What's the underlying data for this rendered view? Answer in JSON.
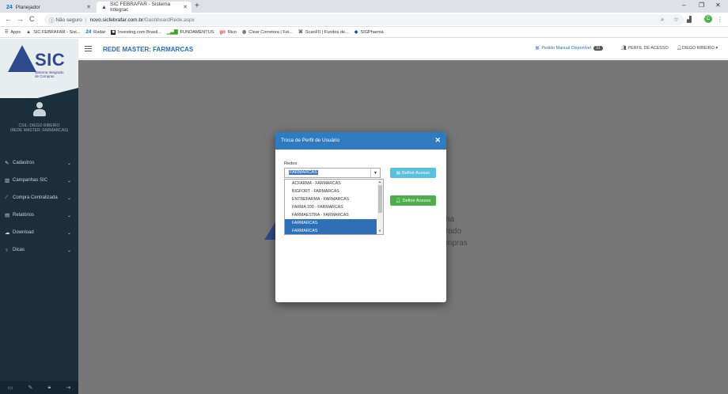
{
  "browser": {
    "tabs": [
      {
        "icon": "24",
        "label": "Planejador",
        "active": false
      },
      {
        "icon": "sic",
        "label": "SIC FEBRAFAR - Sistema Integrac",
        "active": true
      }
    ],
    "address": {
      "security": "Não seguro",
      "host": "novo.sicfebrafar.com.br",
      "path": "/DashboardRede.aspx"
    },
    "avatar_letter": "C",
    "bookmarks": [
      {
        "icon": "apps",
        "label": "Apps"
      },
      {
        "icon": "sic",
        "label": "SIC FEBRAFAR - Sist..."
      },
      {
        "icon": "24",
        "label": "Radar"
      },
      {
        "icon": "inv",
        "label": "Investing.com Brasil..."
      },
      {
        "icon": "chart",
        "label": "FUNDAMENTUS"
      },
      {
        "icon": "go",
        "label": "Rico"
      },
      {
        "icon": "clear",
        "label": "Clear Corretora | Fei..."
      },
      {
        "icon": "fii",
        "label": "ScanFII | Fundos de..."
      },
      {
        "icon": "sig",
        "label": "SIGPharma"
      }
    ]
  },
  "sidebar": {
    "logo_text": "SIC",
    "logo_sub": "Sistema Integrado de Compras",
    "user_line1": "CSIL: DIEGO RIBEIRO",
    "user_line2": "(REDE MASTER: FARMARCAS)",
    "menu": [
      {
        "icon": "edit-icon",
        "label": "Cadastros"
      },
      {
        "icon": "bar-chart-icon",
        "label": "Campanhas SIC"
      },
      {
        "icon": "line-chart-icon",
        "label": "Compra Centralizada"
      },
      {
        "icon": "file-icon",
        "label": "Relatórios"
      },
      {
        "icon": "cloud-download-icon",
        "label": "Download"
      },
      {
        "icon": "lightbulb-icon",
        "label": "Dicas"
      }
    ]
  },
  "header": {
    "title": "REDE MASTER: FARMARCAS",
    "pedido_label": "Pedido Manual Disponível",
    "pedido_count": "31",
    "perfil_label": "PERFIL DE ACESSO",
    "user_label": "DIEGO RIBEIRO"
  },
  "background_text": {
    "line1": "na",
    "line2": "rado",
    "line3": "mpras"
  },
  "modal": {
    "title": "Troca de Perfil de Usuário",
    "redes_label": "Redes:",
    "selected_value": "FARMARCAS",
    "options": [
      "ACFARMA - FARMARCAS",
      "BIGFORT - FARMARCAS",
      "ENTREFARMA - FARMARCAS",
      "FARMA 100 - FARMARCAS",
      "FARMAESTRA - FARMARCAS",
      "FARMARCAS",
      "FARMARCAS"
    ],
    "button1": "Definir Acesso",
    "button2": "Definir Acesso"
  }
}
